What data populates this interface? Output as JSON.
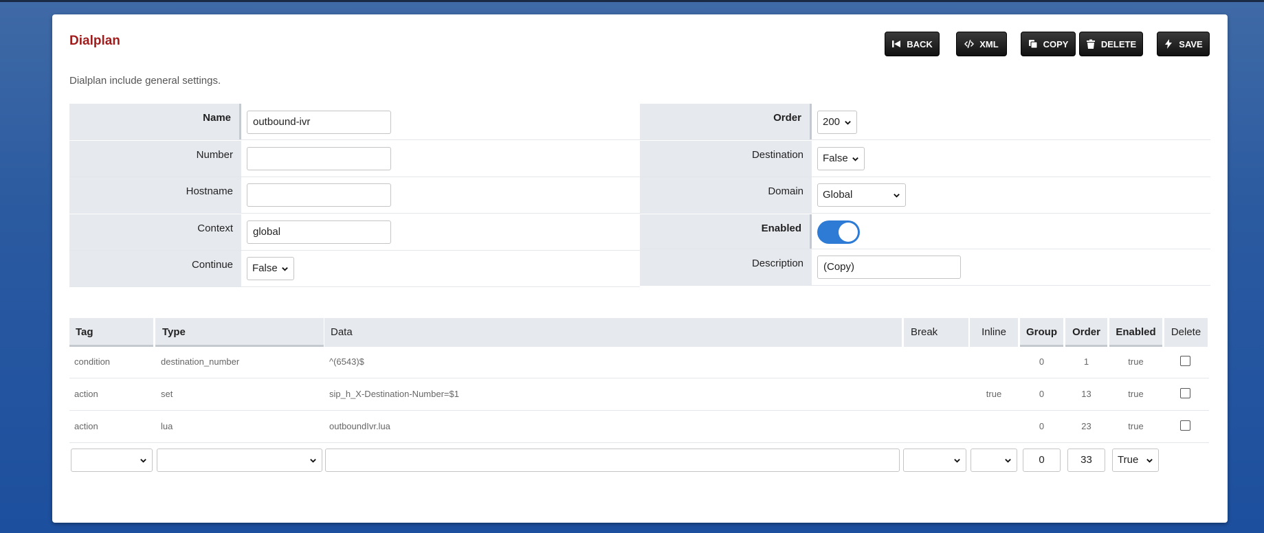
{
  "page": {
    "title": "Dialplan",
    "description": "Dialplan include general settings."
  },
  "toolbar": {
    "back": "BACK",
    "xml": "XML",
    "copy": "COPY",
    "delete": "DELETE",
    "save": "SAVE"
  },
  "settings": {
    "name": {
      "label": "Name",
      "value": "outbound-ivr"
    },
    "number": {
      "label": "Number",
      "value": ""
    },
    "hostname": {
      "label": "Hostname",
      "value": ""
    },
    "context": {
      "label": "Context",
      "value": "global"
    },
    "continue": {
      "label": "Continue",
      "value": "False"
    },
    "order": {
      "label": "Order",
      "value": "200"
    },
    "destination": {
      "label": "Destination",
      "value": "False"
    },
    "domain": {
      "label": "Domain",
      "value": "Global"
    },
    "enabled": {
      "label": "Enabled",
      "value": true
    },
    "description": {
      "label": "Description",
      "value": "(Copy)"
    }
  },
  "details": {
    "columns": {
      "tag": "Tag",
      "type": "Type",
      "data": "Data",
      "break": "Break",
      "inline": "Inline",
      "group": "Group",
      "order": "Order",
      "enabled": "Enabled",
      "delete": "Delete"
    },
    "rows": [
      {
        "tag": "condition",
        "type": "destination_number",
        "data": "^(6543)$",
        "break": "",
        "inline": "",
        "group": "0",
        "order": "1",
        "enabled": "true"
      },
      {
        "tag": "action",
        "type": "set",
        "data": "sip_h_X-Destination-Number=$1",
        "break": "",
        "inline": "true",
        "group": "0",
        "order": "13",
        "enabled": "true"
      },
      {
        "tag": "action",
        "type": "lua",
        "data": "outboundIvr.lua",
        "break": "",
        "inline": "",
        "group": "0",
        "order": "23",
        "enabled": "true"
      }
    ],
    "new_row": {
      "tag": "",
      "type": "",
      "data": "",
      "break": "",
      "inline": "",
      "group": "0",
      "order": "33",
      "enabled": "True"
    }
  },
  "colors": {
    "title": "#a11d1d",
    "toggle_on": "#2e7bd6",
    "label_bg": "#e6e9ee"
  }
}
